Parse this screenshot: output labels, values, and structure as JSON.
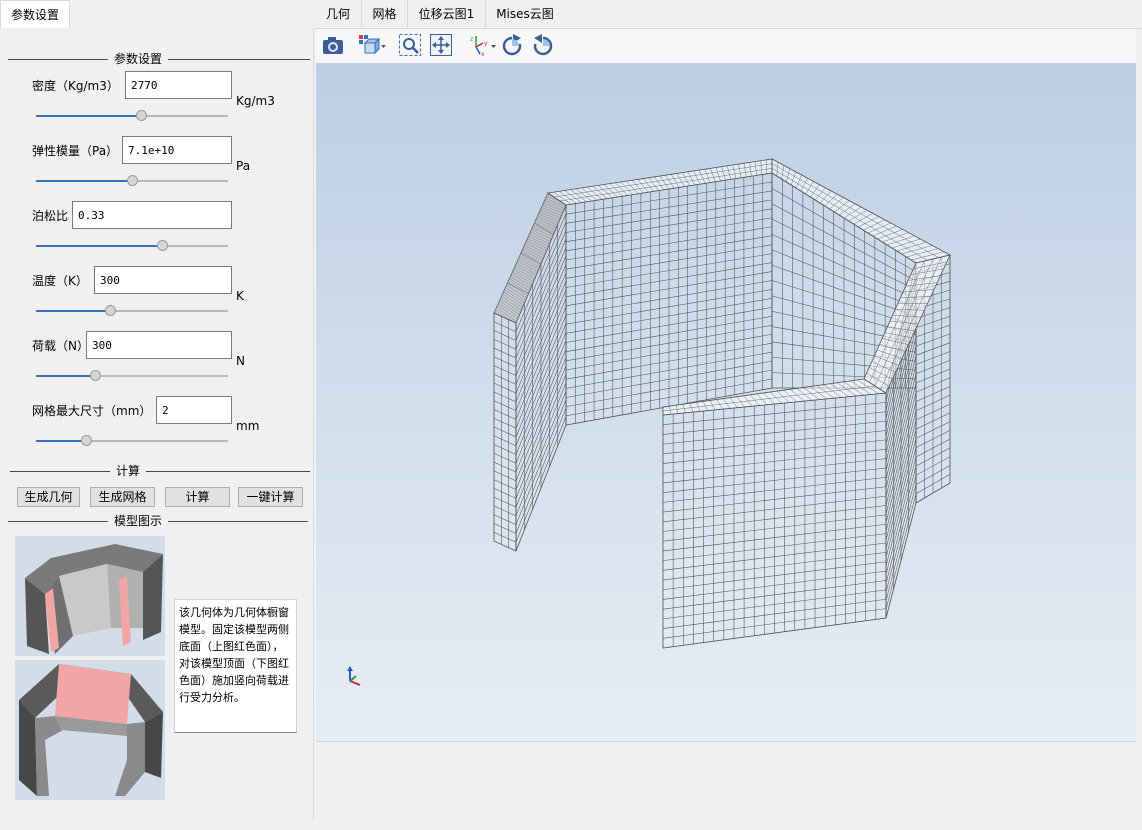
{
  "left_tab": "参数设置",
  "right_tabs": [
    "几何",
    "网格",
    "位移云图1",
    "Mises云图"
  ],
  "params_group_title": "参数设置",
  "fields": [
    {
      "label": "密度（Kg/m3）",
      "value": "2770",
      "unit": "Kg/m3",
      "slider": 0.55
    },
    {
      "label": "弹性模量（Pa）",
      "value": "7.1e+10",
      "unit": "Pa",
      "slider": 0.5
    },
    {
      "label": "泊松比",
      "value": "0.33",
      "unit": "",
      "slider": 0.67
    },
    {
      "label": "温度（K）",
      "value": "300",
      "unit": "K",
      "slider": 0.38
    },
    {
      "label": "荷载（N）",
      "value": "300",
      "unit": "N",
      "slider": 0.3
    },
    {
      "label": "网格最大尺寸（mm）",
      "value": "2",
      "unit": "mm",
      "slider": 0.25
    }
  ],
  "compute_group_title": "计算",
  "buttons": {
    "gen_geometry": "生成几何",
    "gen_mesh": "生成网格",
    "compute": "计算",
    "one_click": "一键计算"
  },
  "model_group_title": "模型图示",
  "description": "该几何体为几何体橱窗模型。固定该模型两侧底面（上图红色面），对该模型顶面（下图红色面）施加竖向荷载进行受力分析。",
  "colors": {
    "slider_fill": "#3d6fb6",
    "highlight_face": "#f2a5a5",
    "viewport_top": "#bccfe5",
    "viewport_bottom": "#e7edf3",
    "mesh_line": "#505050"
  },
  "toolbar_icons": [
    "camera-icon",
    "view-cube-icon",
    "zoom-box-icon",
    "fit-all-icon",
    "axes-orient-icon",
    "rotate-cw-icon",
    "rotate-ccw-icon"
  ]
}
